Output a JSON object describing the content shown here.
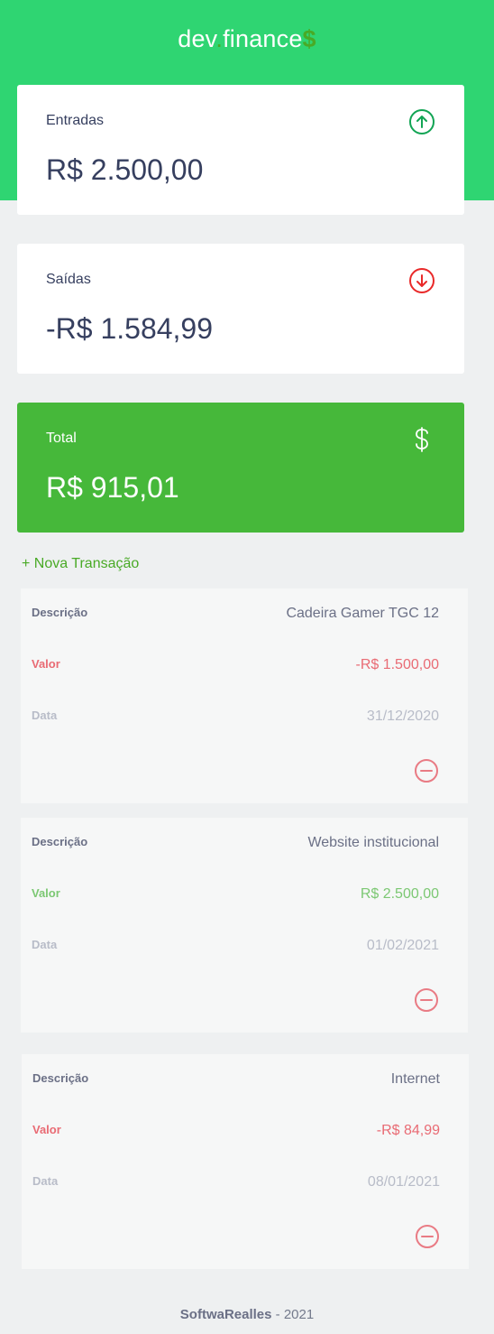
{
  "brand": {
    "prefix": "dev",
    "dot": ".",
    "suffix": "finance",
    "symbol": "$"
  },
  "cards": {
    "income": {
      "label": "Entradas",
      "amount": "R$ 2.500,00",
      "icon": "arrow-up-circle-icon"
    },
    "expense": {
      "label": "Saídas",
      "amount": "-R$ 1.584,99",
      "icon": "arrow-down-circle-icon"
    },
    "total": {
      "label": "Total",
      "amount": "R$ 915,01",
      "icon": "dollar-icon"
    }
  },
  "new_transaction_label": "+ Nova Transação",
  "transactions": [
    {
      "desc_label": "Descrição",
      "desc": "Cadeira Gamer TGC 12",
      "value_label": "Valor",
      "value": "-R$ 1.500,00",
      "date_label": "Data",
      "date": "31/12/2020",
      "type": "expense"
    },
    {
      "desc_label": "Descrição",
      "desc": "Website institucional",
      "value_label": "Valor",
      "value": "R$ 2.500,00",
      "date_label": "Data",
      "date": "01/02/2021",
      "type": "income"
    },
    {
      "desc_label": "Descrição",
      "desc": "Internet",
      "value_label": "Valor",
      "value": "-R$ 84,99",
      "date_label": "Data",
      "date": "08/01/2021",
      "type": "expense"
    }
  ],
  "footer": {
    "author": "SoftwaRealles",
    "year": " - 2021"
  },
  "colors": {
    "header": "#2fd572",
    "total": "#46b83a",
    "income": "#12a454",
    "expense": "#e92929",
    "accent": "#49aa26"
  }
}
